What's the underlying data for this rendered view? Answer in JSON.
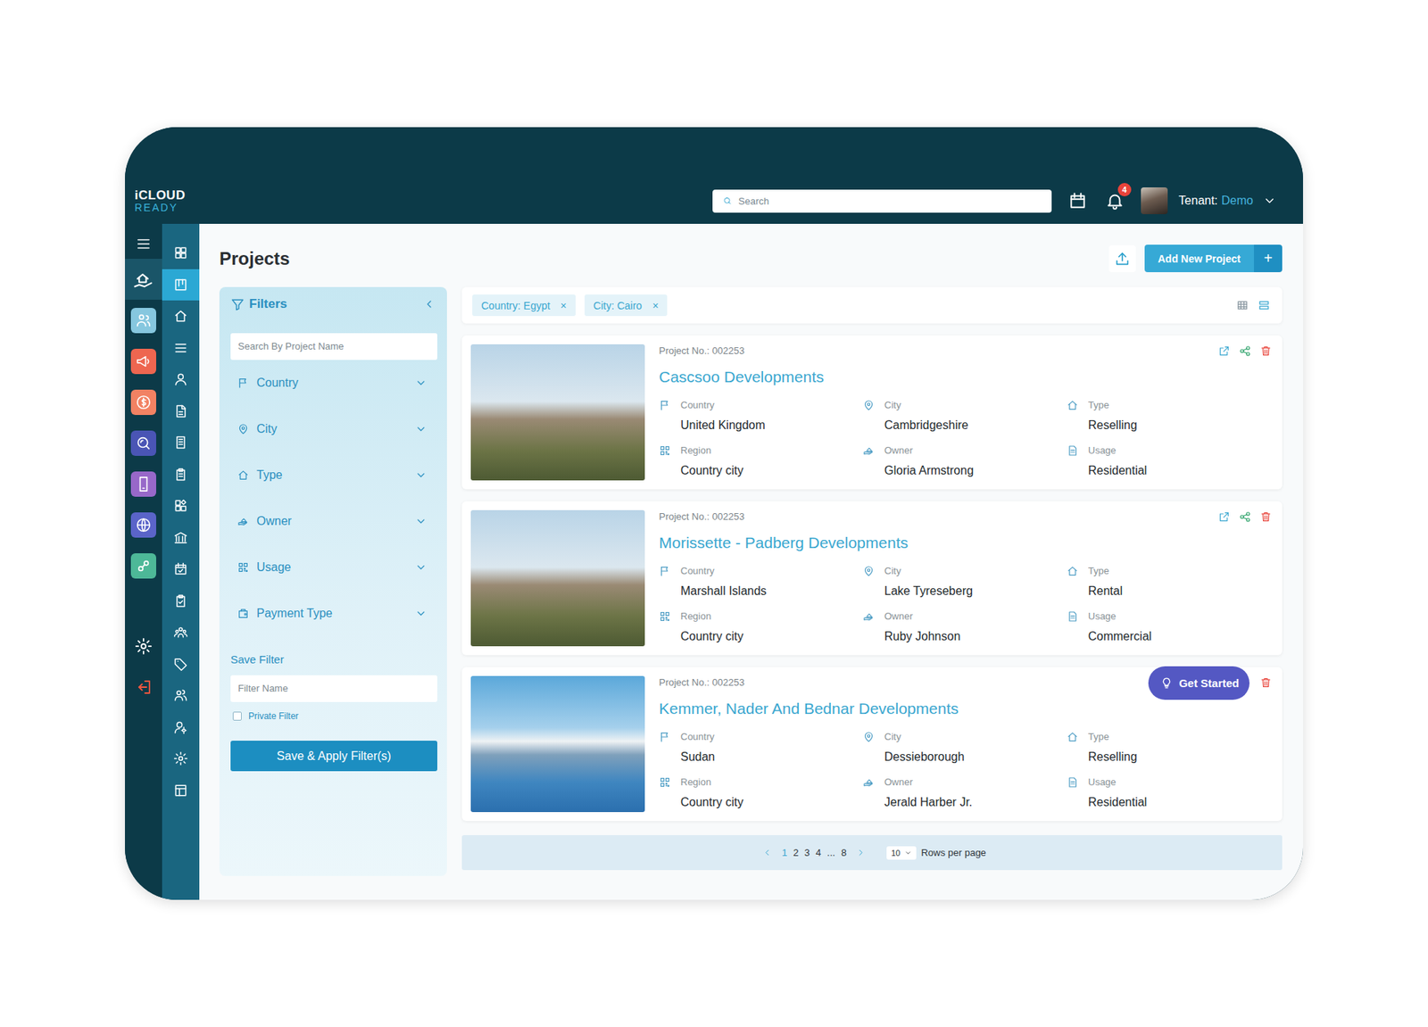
{
  "header": {
    "logo": {
      "top": "iCLOUD",
      "bottom": "READY"
    },
    "search": {
      "placeholder": "Search"
    },
    "notifications": {
      "count": "4"
    },
    "tenant": {
      "label": "Tenant:",
      "value": "Demo"
    }
  },
  "modules": [
    {
      "kind": "plain",
      "selected": true
    },
    {
      "kind": "tile",
      "color": "#86c7df",
      "selected": false
    },
    {
      "kind": "tile",
      "color": "#ee6650",
      "selected": false
    },
    {
      "kind": "tile",
      "color": "#f28263",
      "selected": false
    },
    {
      "kind": "tile",
      "color": "#4a55b5",
      "selected": false
    },
    {
      "kind": "tile",
      "color": "#9868c9",
      "selected": false
    },
    {
      "kind": "tile",
      "color": "#5a64c9",
      "selected": false
    },
    {
      "kind": "tile",
      "color": "#4db898",
      "selected": false
    }
  ],
  "nav": [
    {
      "selected": false
    },
    {
      "selected": true
    },
    {
      "selected": false
    },
    {
      "selected": false
    },
    {
      "selected": false
    },
    {
      "selected": false
    },
    {
      "selected": false
    },
    {
      "selected": false
    },
    {
      "selected": false
    },
    {
      "selected": false
    },
    {
      "selected": false
    },
    {
      "selected": false
    },
    {
      "selected": false
    },
    {
      "selected": false
    },
    {
      "selected": false
    },
    {
      "selected": false
    },
    {
      "selected": false
    },
    {
      "selected": false
    }
  ],
  "page": {
    "title": "Projects",
    "add_button": {
      "label": "Add New Project",
      "icon": "+"
    }
  },
  "filters": {
    "title": "Filters",
    "search_placeholder": "Search By Project Name",
    "dropdowns": [
      {
        "label": "Country",
        "expanded": false
      },
      {
        "label": "City",
        "expanded": false
      },
      {
        "label": "Type",
        "expanded": false
      },
      {
        "label": "Owner",
        "expanded": false
      },
      {
        "label": "Usage",
        "expanded": false
      },
      {
        "label": "Payment Type",
        "expanded": false
      }
    ],
    "save_title": "Save Filter",
    "name_placeholder": "Filter Name",
    "private": {
      "label": "Private Filter",
      "checked": false
    },
    "submit": "Save & Apply Filter(s)"
  },
  "active_filters": [
    {
      "label": "Country: Egypt",
      "remove": "×"
    },
    {
      "label": "City: Cairo",
      "remove": "×"
    }
  ],
  "view_modes": [
    {
      "selected": false
    },
    {
      "selected": true
    }
  ],
  "projects": [
    {
      "number": "Project No.: 002253",
      "title": "Cascsoo Developments",
      "kind": "standard",
      "fields": [
        {
          "label": "Country",
          "value": "United Kingdom"
        },
        {
          "label": "City",
          "value": "Cambridgeshire"
        },
        {
          "label": "Type",
          "value": "Reselling"
        },
        {
          "label": "Region",
          "value": "Country city"
        },
        {
          "label": "Owner",
          "value": "Gloria Armstrong"
        },
        {
          "label": "Usage",
          "value": "Residential"
        }
      ]
    },
    {
      "number": "Project No.: 002253",
      "title": "Morissette - Padberg Developments",
      "kind": "standard",
      "fields": [
        {
          "label": "Country",
          "value": "Marshall Islands"
        },
        {
          "label": "City",
          "value": "Lake Tyreseberg"
        },
        {
          "label": "Type",
          "value": "Rental"
        },
        {
          "label": "Region",
          "value": "Country city"
        },
        {
          "label": "Owner",
          "value": "Ruby Johnson"
        },
        {
          "label": "Usage",
          "value": "Commercial"
        }
      ]
    },
    {
      "number": "Project No.: 002253",
      "title": "Kemmer, Nader And Bednar Developments",
      "kind": "starter",
      "cta": "Get Started",
      "fields": [
        {
          "label": "Country",
          "value": "Sudan"
        },
        {
          "label": "City",
          "value": "Dessieborough"
        },
        {
          "label": "Type",
          "value": "Reselling"
        },
        {
          "label": "Region",
          "value": "Country city"
        },
        {
          "label": "Owner",
          "value": "Jerald Harber Jr."
        },
        {
          "label": "Usage",
          "value": "Residential"
        }
      ]
    }
  ],
  "pagination": {
    "pages": [
      {
        "label": "1",
        "selected": true
      },
      {
        "label": "2",
        "selected": false
      },
      {
        "label": "3",
        "selected": false
      },
      {
        "label": "4",
        "selected": false
      },
      {
        "label": "...",
        "selected": false
      },
      {
        "label": "8",
        "selected": false
      }
    ],
    "rows_per_page": {
      "value": "10",
      "label": "Rows per page"
    }
  }
}
